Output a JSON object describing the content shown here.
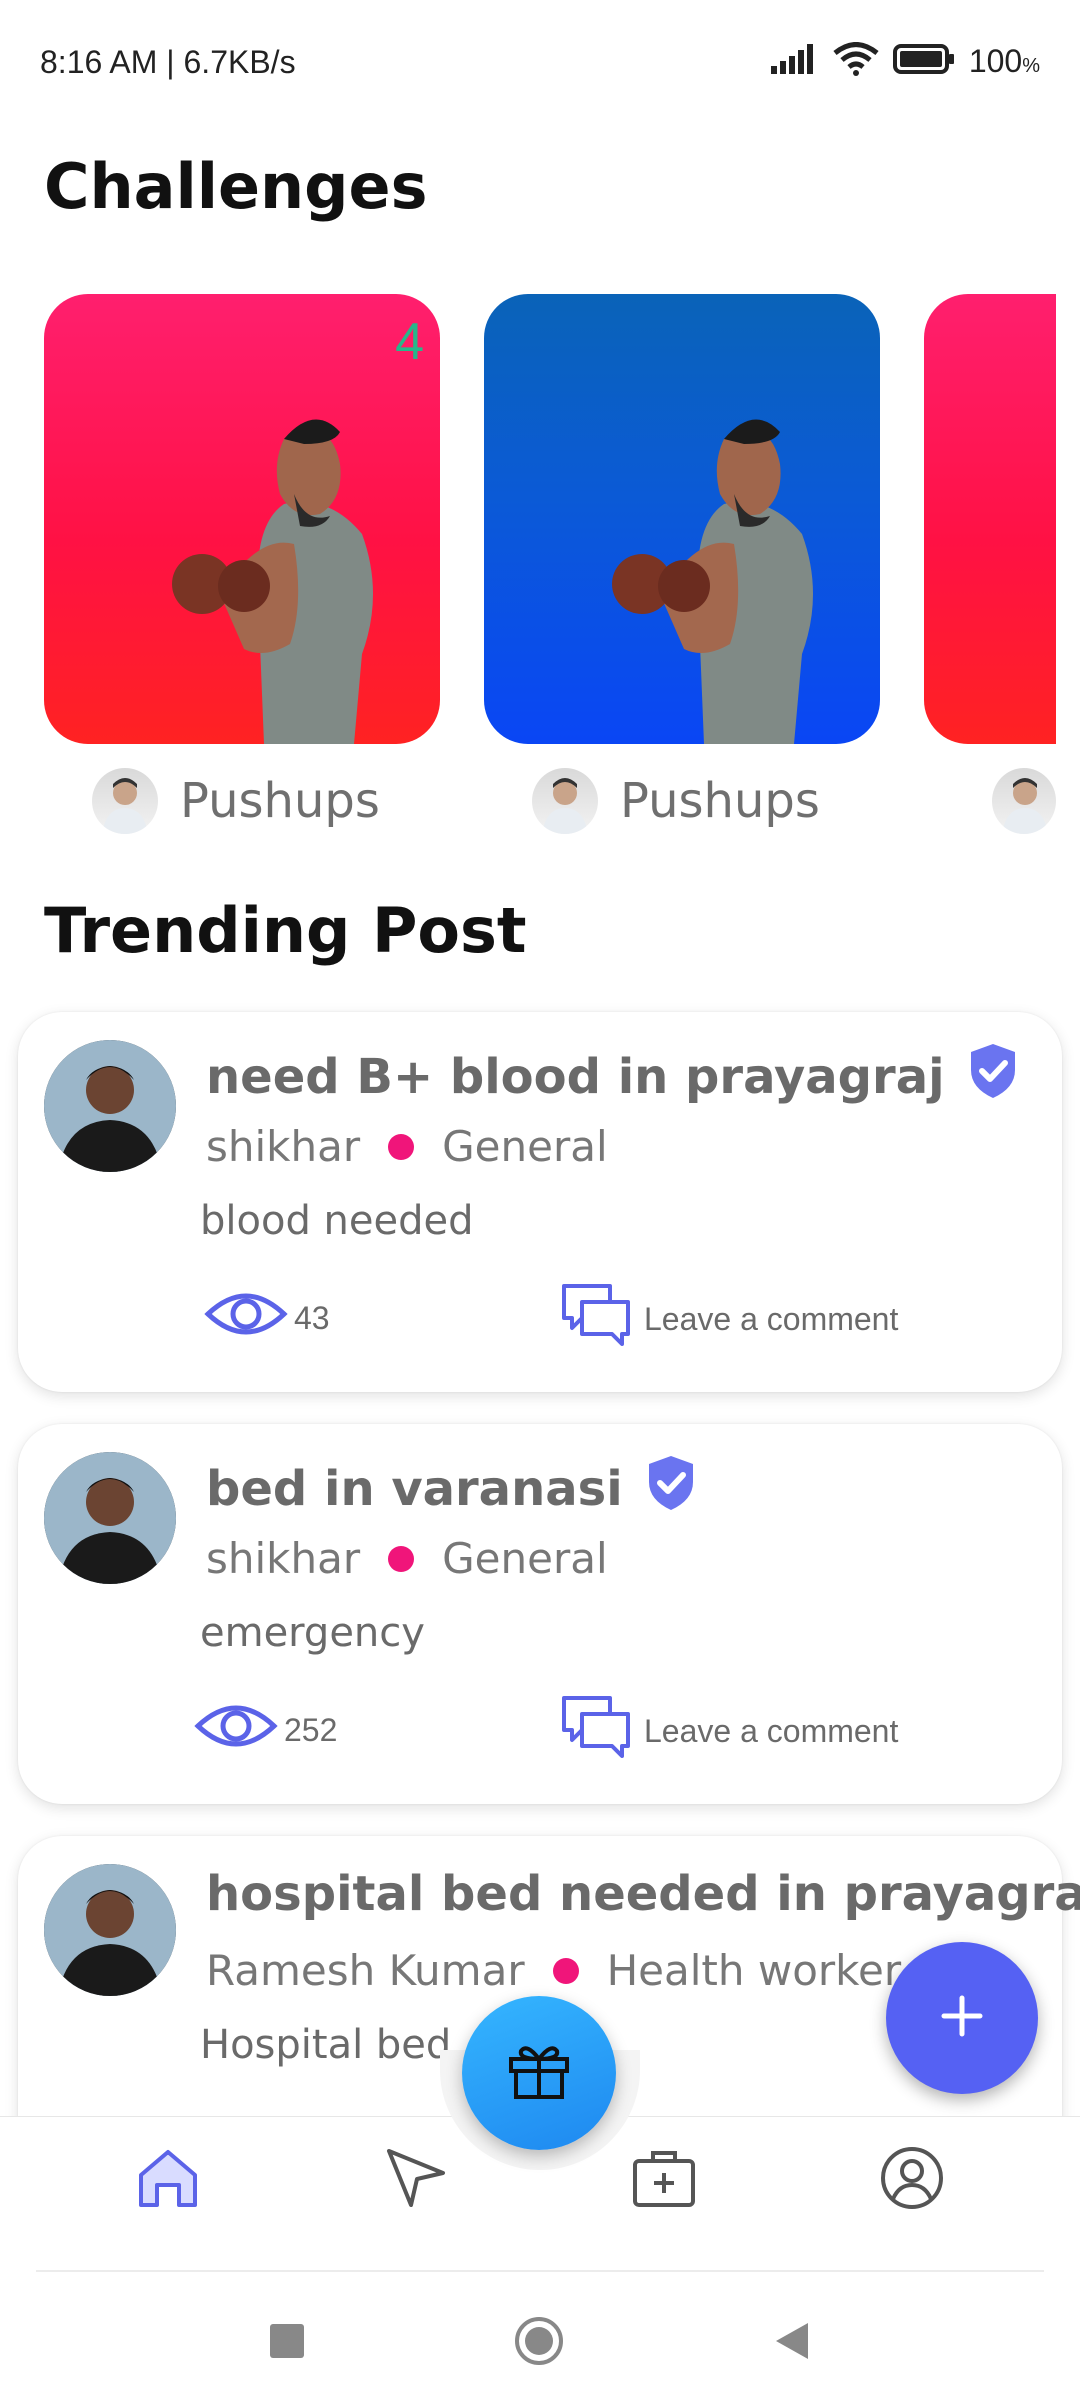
{
  "status_bar": {
    "time": "8:16 AM | 6.7KB/s",
    "battery": "100",
    "battery_unit": "%"
  },
  "sections": {
    "challenges": "Challenges",
    "trending": "Trending Post"
  },
  "challenges": [
    {
      "name": "Pushups",
      "count": "4",
      "color": "red"
    },
    {
      "name": "Pushups",
      "count": "",
      "color": "blue"
    },
    {
      "name": "",
      "count": "",
      "color": "red"
    }
  ],
  "posts": [
    {
      "title": "need B+ blood in prayagraj",
      "author": "shikhar",
      "category": "General",
      "body": "blood needed",
      "views": "43",
      "comment_label": "Leave a comment",
      "verified": true
    },
    {
      "title": "bed in varanasi",
      "author": "shikhar",
      "category": "General",
      "body": "emergency",
      "views": "252",
      "comment_label": "Leave a comment",
      "verified": true
    },
    {
      "title": "hospital bed needed in prayagraj",
      "author": "Ramesh Kumar",
      "category": "Health worker",
      "body": "Hospital bed",
      "views": "",
      "comment_label": "",
      "verified": false
    }
  ],
  "colors": {
    "accent": "#5561f3",
    "dot": "#f0157a",
    "green_count": "#27b78a"
  },
  "nav": {
    "items": [
      "home-icon",
      "send-icon",
      "medical-kit-icon",
      "profile-icon"
    ],
    "active": "home-icon"
  }
}
